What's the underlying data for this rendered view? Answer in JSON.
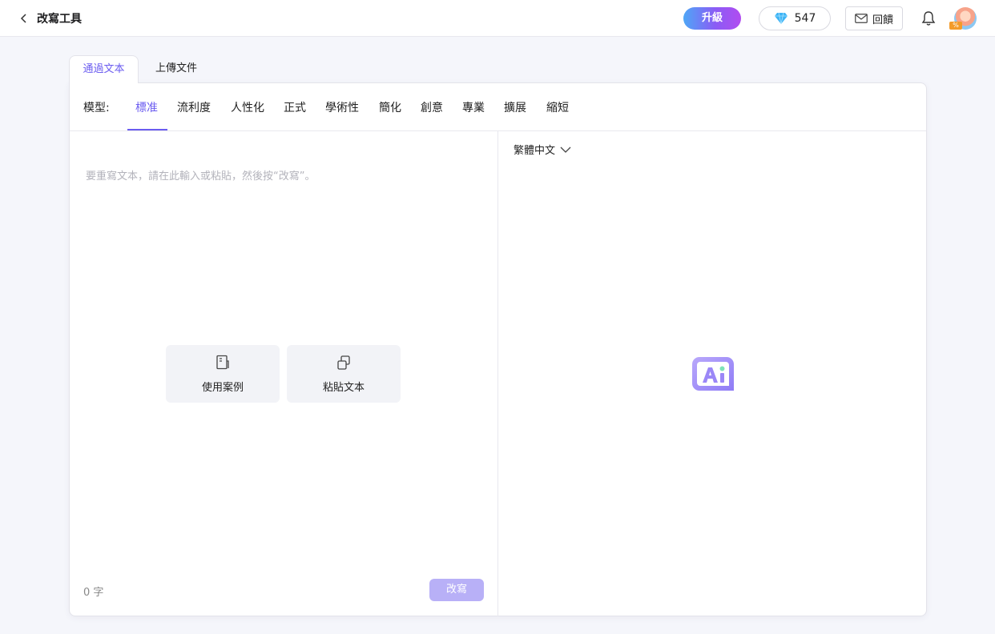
{
  "header": {
    "title": "改寫工具",
    "upgrade_label": "升級",
    "credits": "547",
    "feedback_label": "回饋",
    "avatar_badge": "%"
  },
  "tabs": [
    {
      "label": "通過文本",
      "active": true
    },
    {
      "label": "上傳文件",
      "active": false
    }
  ],
  "model": {
    "label": "模型:",
    "items": [
      "標准",
      "流利度",
      "人性化",
      "正式",
      "學術性",
      "簡化",
      "創意",
      "專業",
      "擴展",
      "縮短"
    ],
    "selected": "標准"
  },
  "editor": {
    "placeholder": "要重寫文本，請在此輸入或粘貼，然後按“改寫”。",
    "actions": [
      {
        "label": "使用案例",
        "icon": "book-icon"
      },
      {
        "label": "粘貼文本",
        "icon": "paste-icon"
      }
    ],
    "word_count": "0 字",
    "submit_label": "改寫"
  },
  "output": {
    "language": "繁體中文"
  },
  "colors": {
    "accent": "#6b5cf0",
    "button_disabled": "#b8b0f7",
    "upgrade_gradient_start": "#4ea7f6",
    "upgrade_gradient_end": "#b14cf0"
  }
}
